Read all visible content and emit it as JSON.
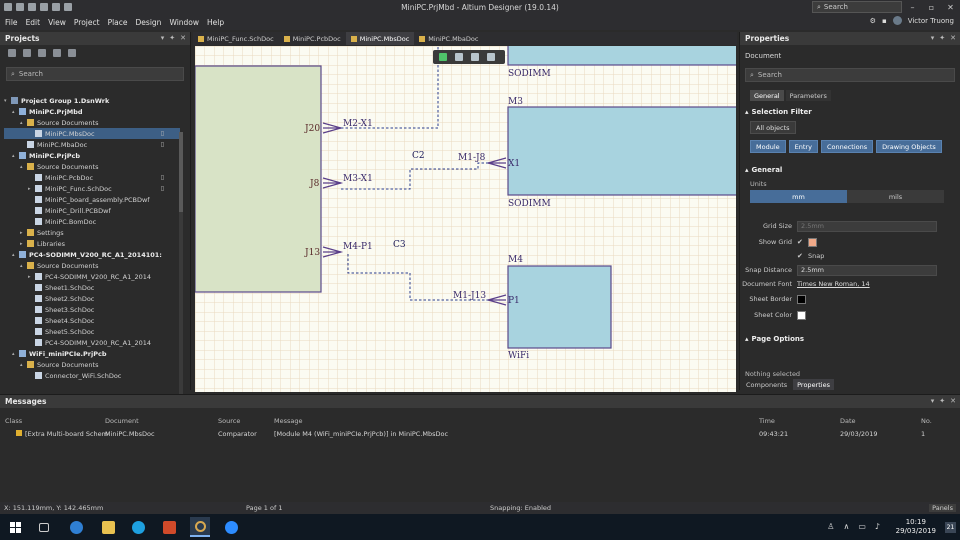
{
  "window": {
    "title": "MiniPC.PrjMbd - Altium Designer (19.0.14)",
    "search_placeholder": "Search"
  },
  "menu": {
    "items": [
      "File",
      "Edit",
      "View",
      "Project",
      "Place",
      "Design",
      "Window",
      "Help"
    ],
    "user": "Victor Truong"
  },
  "projects": {
    "title": "Projects",
    "search_placeholder": "Search",
    "tree": [
      {
        "label": "Project Group 1.DsnWrk",
        "level": 0,
        "bold": true,
        "icon": "group-icon",
        "arrow": "▾"
      },
      {
        "label": "MiniPC.PrjMbd",
        "level": 1,
        "bold": true,
        "icon": "project-icon",
        "arrow": "▴"
      },
      {
        "label": "Source Documents",
        "level": 2,
        "bold": false,
        "icon": "folder-icon",
        "arrow": "▴"
      },
      {
        "label": "MiniPC.MbsDoc",
        "level": 3,
        "bold": false,
        "icon": "doc-icon",
        "arrow": "",
        "selected": true,
        "flag": "▯"
      },
      {
        "label": "MiniPC.MbaDoc",
        "level": 2,
        "bold": false,
        "icon": "doc-icon",
        "arrow": "",
        "flag": "▯"
      },
      {
        "label": "MiniPC.PrjPcb",
        "level": 1,
        "bold": true,
        "icon": "project-icon",
        "arrow": "▴"
      },
      {
        "label": "Source Documents",
        "level": 2,
        "bold": false,
        "icon": "folder-icon",
        "arrow": "▴"
      },
      {
        "label": "MiniPC.PcbDoc",
        "level": 3,
        "bold": false,
        "icon": "doc-icon",
        "arrow": "",
        "flag": "▯"
      },
      {
        "label": "MiniPC_Func.SchDoc",
        "level": 3,
        "bold": false,
        "icon": "doc-icon",
        "arrow": "▸",
        "flag": "▯"
      },
      {
        "label": "MiniPC_board_assembly.PCBDwf",
        "level": 3,
        "bold": false,
        "icon": "doc-icon",
        "arrow": ""
      },
      {
        "label": "MiniPC_Drill.PCBDwf",
        "level": 3,
        "bold": false,
        "icon": "doc-icon",
        "arrow": ""
      },
      {
        "label": "MiniPC.BomDoc",
        "level": 3,
        "bold": false,
        "icon": "doc-icon",
        "arrow": ""
      },
      {
        "label": "Settings",
        "level": 2,
        "bold": false,
        "icon": "folder-icon",
        "arrow": "▸"
      },
      {
        "label": "Libraries",
        "level": 2,
        "bold": false,
        "icon": "folder-icon",
        "arrow": "▸"
      },
      {
        "label": "PC4-SODIMM_V200_RC_A1_2014101:",
        "level": 1,
        "bold": true,
        "icon": "project-icon",
        "arrow": "▴"
      },
      {
        "label": "Source Documents",
        "level": 2,
        "bold": false,
        "icon": "folder-icon",
        "arrow": "▴"
      },
      {
        "label": "PC4-SODIMM_V200_RC_A1_2014",
        "level": 3,
        "bold": false,
        "icon": "doc-icon",
        "arrow": "▸"
      },
      {
        "label": "Sheet1.SchDoc",
        "level": 3,
        "bold": false,
        "icon": "doc-icon",
        "arrow": ""
      },
      {
        "label": "Sheet2.SchDoc",
        "level": 3,
        "bold": false,
        "icon": "doc-icon",
        "arrow": ""
      },
      {
        "label": "Sheet3.SchDoc",
        "level": 3,
        "bold": false,
        "icon": "doc-icon",
        "arrow": ""
      },
      {
        "label": "Sheet4.SchDoc",
        "level": 3,
        "bold": false,
        "icon": "doc-icon",
        "arrow": ""
      },
      {
        "label": "Sheet5.SchDoc",
        "level": 3,
        "bold": false,
        "icon": "doc-icon",
        "arrow": ""
      },
      {
        "label": "PC4-SODIMM_V200_RC_A1_2014",
        "level": 3,
        "bold": false,
        "icon": "doc-icon",
        "arrow": ""
      },
      {
        "label": "WiFi_miniPCIe.PrjPcb",
        "level": 1,
        "bold": true,
        "icon": "project-icon",
        "arrow": "▴"
      },
      {
        "label": "Source Documents",
        "level": 2,
        "bold": false,
        "icon": "folder-icon",
        "arrow": "▴"
      },
      {
        "label": "Connector_WiFi.SchDoc",
        "level": 3,
        "bold": false,
        "icon": "doc-icon",
        "arrow": ""
      }
    ]
  },
  "doc_tabs": [
    {
      "label": "MiniPC_Func.SchDoc",
      "active": false
    },
    {
      "label": "MiniPC.PcbDoc",
      "active": false
    },
    {
      "label": "MiniPC.MbsDoc",
      "active": true
    },
    {
      "label": "MiniPC.MbaDoc",
      "active": false
    }
  ],
  "schematic": {
    "modules": [
      {
        "designator": "",
        "name": "SODIMM",
        "fill": "#a8d3df"
      },
      {
        "designator": "M3",
        "name": "SODIMM",
        "fill": "#a8d3df"
      },
      {
        "designator": "M4",
        "name": "WiFi",
        "fill": "#a8d3df"
      },
      {
        "designator": "",
        "name": "",
        "fill": "#d8e3c6"
      }
    ],
    "ports": [
      "J20",
      "J8",
      "J13",
      "X1",
      "P1"
    ],
    "net_labels": [
      "M2-X1",
      "M3-X1",
      "M4-P1",
      "M1-J8",
      "M1-J13"
    ],
    "connections": [
      "C2",
      "C3"
    ]
  },
  "properties": {
    "title": "Properties",
    "context": "Document",
    "search_placeholder": "Search",
    "tabs": [
      "General",
      "Parameters"
    ],
    "selection_filter": {
      "title": "Selection Filter",
      "all_objects": "All objects",
      "chips": [
        "Module",
        "Entry",
        "Connections",
        "Drawing Objects"
      ]
    },
    "general": {
      "title": "General",
      "units_label": "Units",
      "units": [
        "mm",
        "mils"
      ],
      "grid_size_label": "Grid Size",
      "grid_size": "2.5mm",
      "show_grid_label": "Show Grid",
      "grid_color": "#f0a988",
      "snap_label": "Snap",
      "snap_distance_label": "Snap Distance",
      "snap_distance": "2.5mm",
      "document_font_label": "Document Font",
      "document_font": "Times New Roman, 14",
      "sheet_border_label": "Sheet Border",
      "sheet_border_color": "#000000",
      "sheet_color_label": "Sheet Color",
      "sheet_color": "#ffffff"
    },
    "page_options": "Page Options",
    "nothing_selected": "Nothing selected",
    "bottom_tabs": [
      "Components",
      "Properties"
    ]
  },
  "messages": {
    "title": "Messages",
    "columns": [
      "Class",
      "Document",
      "Source",
      "Message",
      "Time",
      "Date",
      "No."
    ],
    "rows": [
      {
        "class": "[Extra Multi-board Schem",
        "document": "MiniPC.MbsDoc",
        "source": "Comparator",
        "message": "[Module M4 (WiFi_miniPCIe.PrjPcb)] in MiniPC.MbsDoc",
        "time": "09:43:21",
        "date": "29/03/2019",
        "no": "1"
      }
    ]
  },
  "status": {
    "coords": "X: 151.119mm, Y: 142.465mm",
    "page": "Page 1 of 1",
    "snapping": "Snapping: Enabled",
    "panels": "Panels"
  },
  "taskbar": {
    "time": "10:19",
    "date": "29/03/2019",
    "notifications": "21"
  }
}
